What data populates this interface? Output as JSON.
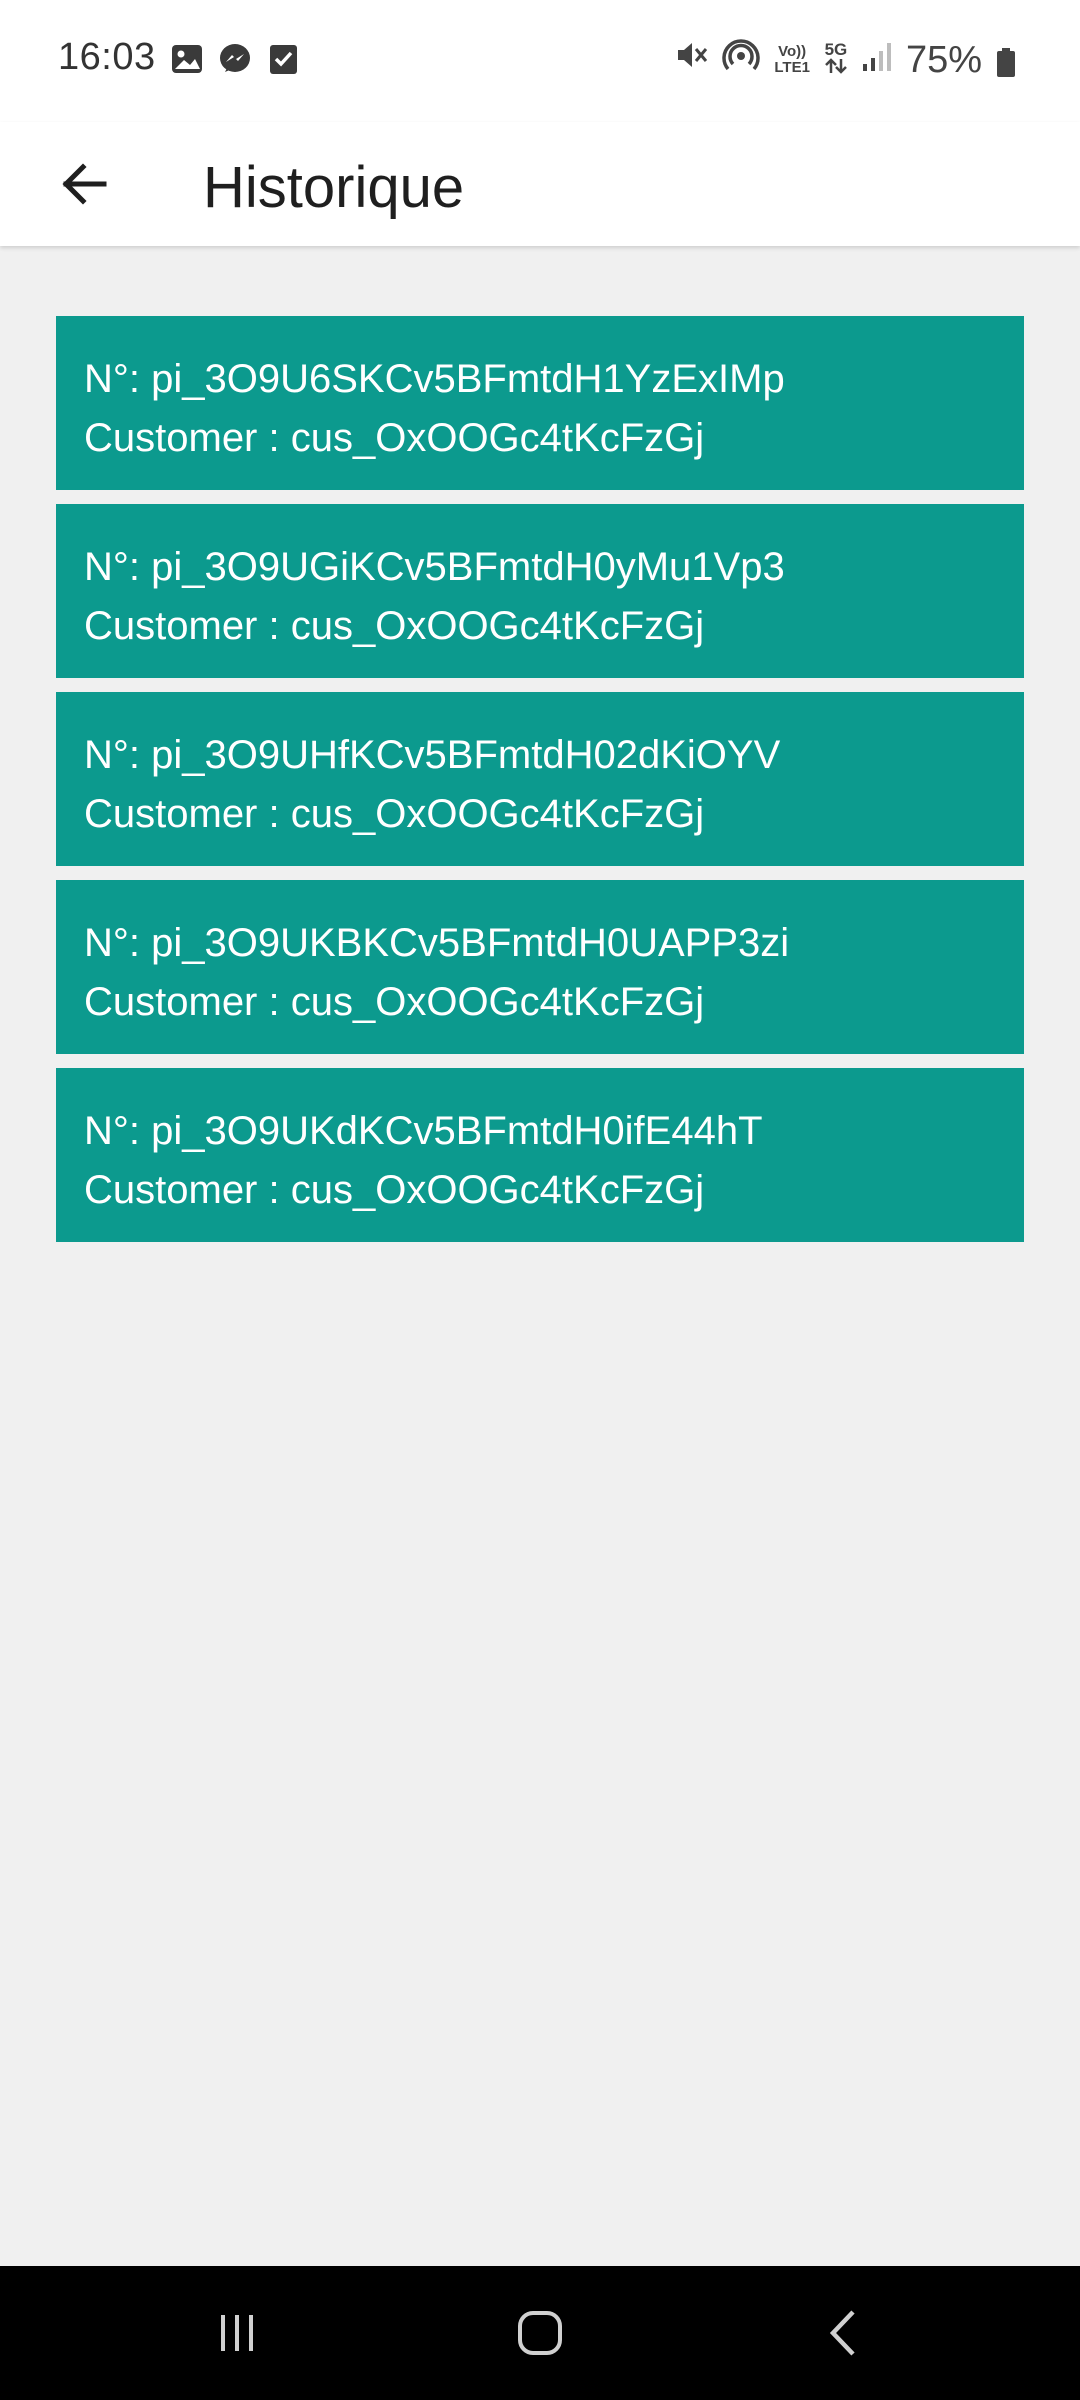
{
  "status_bar": {
    "time": "16:03",
    "left_icons": [
      "gallery-icon",
      "messenger-icon",
      "checkbox-icon"
    ],
    "volte_label_top": "Vo))",
    "volte_label_bottom": "LTE1",
    "network_label": "5G",
    "battery_percent": "75%"
  },
  "app_bar": {
    "title": "Historique",
    "back_icon": "arrow-back-icon"
  },
  "history": {
    "items": [
      {
        "number": "N°: pi_3O9U6SKCv5BFmtdH1YzExIMp",
        "customer": " Customer : cus_OxOOGc4tKcFzGj"
      },
      {
        "number": "N°: pi_3O9UGiKCv5BFmtdH0yMu1Vp3",
        "customer": " Customer : cus_OxOOGc4tKcFzGj"
      },
      {
        "number": "N°: pi_3O9UHfKCv5BFmtdH02dKiOYV",
        "customer": " Customer : cus_OxOOGc4tKcFzGj"
      },
      {
        "number": "N°: pi_3O9UKBKCv5BFmtdH0UAPP3zi",
        "customer": " Customer : cus_OxOOGc4tKcFzGj"
      },
      {
        "number": "N°: pi_3O9UKdKCv5BFmtdH0ifE44hT",
        "customer": " Customer : cus_OxOOGc4tKcFzGj"
      }
    ]
  },
  "nav_bar": {
    "recents_icon": "recents-icon",
    "home_icon": "home-icon",
    "back_icon": "nav-back-icon"
  },
  "colors": {
    "card_bg": "#0c9a8e",
    "page_bg": "#f0f0f0",
    "app_bar_bg": "#ffffff",
    "nav_bar_bg": "#000000"
  }
}
